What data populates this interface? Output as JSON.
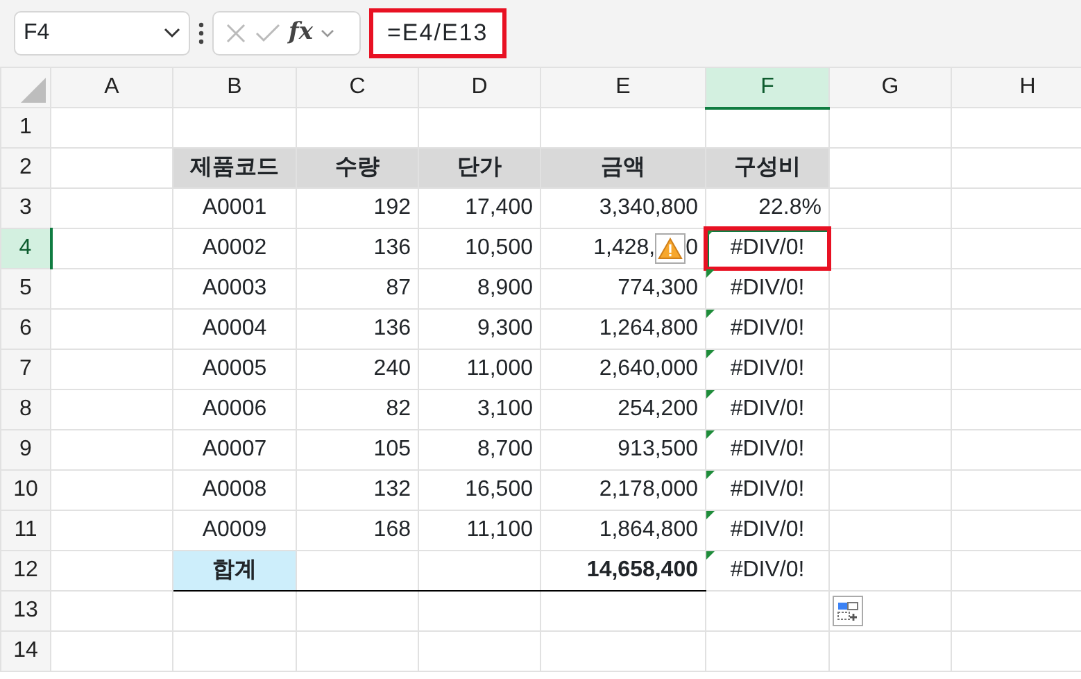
{
  "formula_bar": {
    "name_box": "F4",
    "formula": "=E4/E13",
    "highlighted": true,
    "fx": "fx"
  },
  "columns": [
    {
      "label": "A",
      "selected": false
    },
    {
      "label": "B",
      "selected": false
    },
    {
      "label": "C",
      "selected": false
    },
    {
      "label": "D",
      "selected": false
    },
    {
      "label": "E",
      "selected": false
    },
    {
      "label": "F",
      "selected": true
    },
    {
      "label": "G",
      "selected": false
    },
    {
      "label": "H",
      "selected": false
    }
  ],
  "row_headers": [
    {
      "label": "1",
      "selected": false
    },
    {
      "label": "2",
      "selected": false
    },
    {
      "label": "3",
      "selected": false
    },
    {
      "label": "4",
      "selected": true
    },
    {
      "label": "5",
      "selected": false
    },
    {
      "label": "6",
      "selected": false
    },
    {
      "label": "7",
      "selected": false
    },
    {
      "label": "8",
      "selected": false
    },
    {
      "label": "9",
      "selected": false
    },
    {
      "label": "10",
      "selected": false
    },
    {
      "label": "11",
      "selected": false
    },
    {
      "label": "12",
      "selected": false
    },
    {
      "label": "13",
      "selected": false
    },
    {
      "label": "14",
      "selected": false
    }
  ],
  "header": [
    "제품코드",
    "수량",
    "단가",
    "금액",
    "구성비"
  ],
  "items": [
    {
      "code": "A0001",
      "qty": "192",
      "price": "17,400",
      "amount": "3,340,800",
      "ratio": "22.8%",
      "error_flag": false,
      "selected": false,
      "highlighted": false,
      "warning": false
    },
    {
      "code": "A0002",
      "qty": "136",
      "price": "10,500",
      "amount": "1,428,",
      "amount_after": "0",
      "ratio": "#DIV/0!",
      "error_flag": true,
      "selected": true,
      "highlighted": true,
      "warning": true
    },
    {
      "code": "A0003",
      "qty": "87",
      "price": "8,900",
      "amount": "774,300",
      "ratio": "#DIV/0!",
      "error_flag": true,
      "selected": false,
      "highlighted": false,
      "warning": false
    },
    {
      "code": "A0004",
      "qty": "136",
      "price": "9,300",
      "amount": "1,264,800",
      "ratio": "#DIV/0!",
      "error_flag": true,
      "selected": false,
      "highlighted": false,
      "warning": false
    },
    {
      "code": "A0005",
      "qty": "240",
      "price": "11,000",
      "amount": "2,640,000",
      "ratio": "#DIV/0!",
      "error_flag": true,
      "selected": false,
      "highlighted": false,
      "warning": false
    },
    {
      "code": "A0006",
      "qty": "82",
      "price": "3,100",
      "amount": "254,200",
      "ratio": "#DIV/0!",
      "error_flag": true,
      "selected": false,
      "highlighted": false,
      "warning": false
    },
    {
      "code": "A0007",
      "qty": "105",
      "price": "8,700",
      "amount": "913,500",
      "ratio": "#DIV/0!",
      "error_flag": true,
      "selected": false,
      "highlighted": false,
      "warning": false
    },
    {
      "code": "A0008",
      "qty": "132",
      "price": "16,500",
      "amount": "2,178,000",
      "ratio": "#DIV/0!",
      "error_flag": true,
      "selected": false,
      "highlighted": false,
      "warning": false
    },
    {
      "code": "A0009",
      "qty": "168",
      "price": "11,100",
      "amount": "1,864,800",
      "ratio": "#DIV/0!",
      "error_flag": true,
      "selected": false,
      "highlighted": false,
      "warning": false
    }
  ],
  "total": {
    "label": "합계",
    "amount": "14,658,400",
    "ratio": "#DIV/0!",
    "error_flag": true
  },
  "paste_options": true
}
